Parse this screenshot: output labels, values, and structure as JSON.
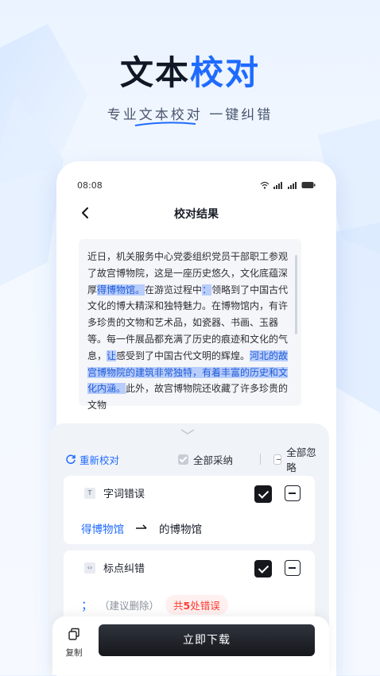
{
  "hero": {
    "title_main": "文本",
    "title_accent": "校对",
    "subtitle": "专业文本校对  一键纠错"
  },
  "status": {
    "time": "08:08"
  },
  "nav": {
    "title": "校对结果"
  },
  "document": {
    "seg1": "近日，机关服务中心党委组织党员干部职工参观了故宫博物院，这是一座历史悠久，文化底蕴深厚",
    "hl1": "得博物馆。",
    "seg2": "在游览过程中",
    "hl2": "：",
    "seg3": "领略到了中国古代文化的博大精深和独特魅力。在博物馆内，有许多珍贵的文物和艺术品，如瓷器、书画、玉器等。每一件展品都充满了历史的痕迹和文化的气息，",
    "hl3": "让",
    "seg4": "感受到了中国古代文明的辉煌。",
    "hl4": "河北的故宫博物院的建筑非常独特，有着丰富的历史和文化内涵。",
    "seg5": "此外，故宫博物院还收藏了许多珍贵的文物"
  },
  "actions": {
    "redo": "重新校对",
    "accept_all": "全部采纳",
    "ignore_all": "全部忽略"
  },
  "cards": [
    {
      "category": "字词错误",
      "icon": "text-icon",
      "wrong": "得博物馆",
      "correct": "的博物馆"
    },
    {
      "category": "标点纠错",
      "icon": "punctuation-icon",
      "mark": "；",
      "suggestion": "（建议删除）",
      "count_prefix": "共",
      "count_value": "5",
      "count_suffix": "处错误"
    }
  ],
  "bottom": {
    "copy_label": "复制",
    "download_label": "立即下载"
  },
  "colors": {
    "accent": "#1f6bff",
    "highlight": "#b8cdfc",
    "error": "#ff3b30"
  }
}
